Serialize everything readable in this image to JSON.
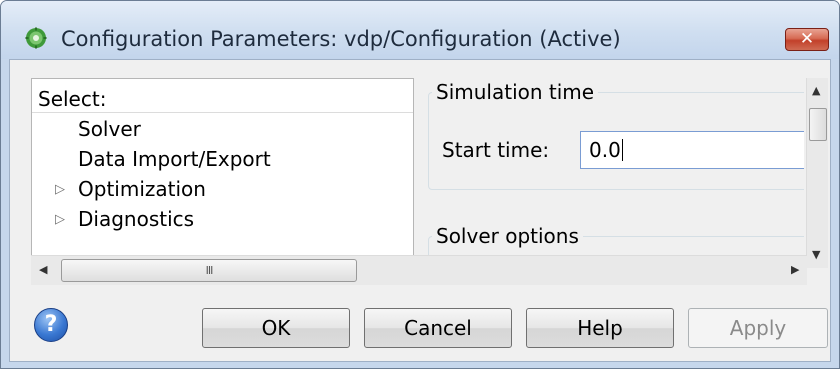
{
  "window": {
    "title": "Configuration Parameters: vdp/Configuration (Active)",
    "app_icon": "gear-icon",
    "close_label": "✕"
  },
  "tree": {
    "header": "Select:",
    "items": [
      {
        "label": "Solver",
        "expandable": false
      },
      {
        "label": "Data Import/Export",
        "expandable": false
      },
      {
        "label": "Optimization",
        "expandable": true
      },
      {
        "label": "Diagnostics",
        "expandable": true
      }
    ]
  },
  "simulation_time": {
    "group_title": "Simulation time",
    "start_time_label": "Start time:",
    "start_time_value": "0.0"
  },
  "solver_options": {
    "group_title": "Solver options"
  },
  "scrollbar": {
    "grip": "III"
  },
  "buttons": {
    "help_icon": "?",
    "ok": "OK",
    "cancel": "Cancel",
    "help": "Help",
    "apply": "Apply"
  }
}
